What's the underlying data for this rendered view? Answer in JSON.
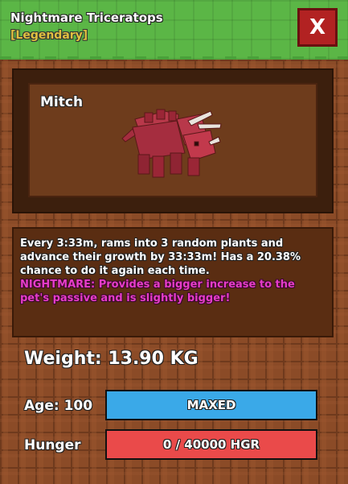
{
  "header": {
    "pet_type": "Nightmare Triceratops",
    "rarity": "[Legendary]",
    "close_label": "X"
  },
  "pet": {
    "name": "Mitch",
    "image": "triceratops-pet-icon"
  },
  "description": {
    "passive": "Every 3:33m, rams into 3 random plants and advance their growth by 33:33m! Has a 20.38% chance to do it again each time.",
    "nightmare": "NIGHTMARE: Provides a bigger increase to the pet's passive and is slightly bigger!"
  },
  "stats": {
    "weight": "Weight: 13.90 KG",
    "age_label": "Age: 100",
    "age_bar_text": "MAXED",
    "age_fill": 1.0,
    "hunger_label": "Hunger",
    "hunger_bar_text": "0 / 40000 HGR",
    "hunger_fill": 1.0
  },
  "colors": {
    "age_bar": "#3aa9e8",
    "hunger_bar": "#ea4a4a",
    "nightmare_text": "#e63cc8",
    "rarity_text": "#e0c040"
  }
}
